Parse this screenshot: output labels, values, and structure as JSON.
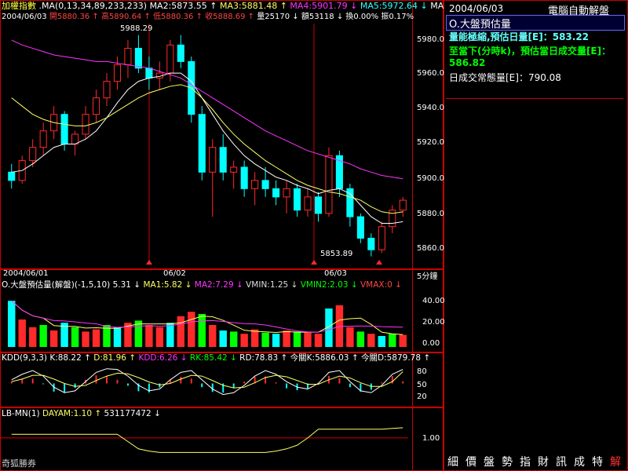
{
  "colors": {
    "up": "#ff2a2a",
    "down": "#00ffff",
    "ma_white": "#ffffff",
    "ma_yellow": "#ffff66",
    "ma_magenta": "#ff33ff",
    "volume_green": "#00ff00",
    "grid_red": "#cc0000"
  },
  "main": {
    "title": "加權指數",
    "ma_header": ".MA(0,13,34,89,233,233)",
    "ma2": "MA2:5873.55 ↑",
    "ma3": "MA3:5881.48 ↑",
    "ma4": "MA4:5901.79 ↓",
    "ma5": "MA5:5972.64 ↓",
    "ma_more": "MA",
    "date": "2004/06/03",
    "open": "開5880.36 ↑",
    "high": "高5890.64 ↑",
    "low": "低5880.36 ↑",
    "close": "收5888.69 ↑",
    "vol": "量25170 ↓",
    "amount": "額53118 ↓",
    "turnover": "換0.00%",
    "amplitude": "振0.17%",
    "yticks": [
      "5980.0",
      "5960.0",
      "5940.0",
      "5920.0",
      "5900.0",
      "5880.0",
      "5860.0"
    ],
    "annot_high": "5988.29",
    "annot_low": "5853.89",
    "x_labels": [
      "2004/06/01",
      "06/02",
      "06/03"
    ],
    "interval": "5分鐘"
  },
  "vol_panel": {
    "title": "O.大盤預估量(解盤)(-1,5,10)",
    "value": "5.31 ↓",
    "ma1": "MA1:5.82 ↓",
    "ma2": "MA2:7.29 ↓",
    "vmin": "VMIN:1.25 ↓",
    "vmin2": "VMIN2:2.03 ↓",
    "vmax": "VMAX:0 ↓",
    "yticks": [
      "40.00",
      "20.00",
      "0.00"
    ]
  },
  "kdd": {
    "title": "KDD(9,3,3)",
    "k": "K:88.22 ↑",
    "d": "D:81.96 ↑",
    "kdd": "KDD:6.26 ↓",
    "rk": "RK:85.42 ↓",
    "rd": "RD:78.83 ↑",
    "today_k": "今關K:5886.03 ↑",
    "today_d": "今關D:5879.78 ↑",
    "yticks": [
      "80",
      "50",
      "20"
    ]
  },
  "lbmn": {
    "title": "LB-MN(1)",
    "dayam": "DAYAM:1.10 ↑",
    "value": "531177472 ↓",
    "ytick": "1.00"
  },
  "footer": {
    "broker": "奇狐勝券"
  },
  "side": {
    "date": "2004/06/03",
    "brand": "電腦自動解盤",
    "section_title": "O.大盤預估量",
    "line1": "量能極縮,預估日量[E]：583.22",
    "line2": "至當下(分時k)，預估當日成交量[E]：586.82",
    "line3": "日成交常態量[E]：790.08",
    "buttons": [
      "細",
      "價",
      "盤",
      "勢",
      "指",
      "財",
      "訊",
      "成",
      "特",
      "解"
    ]
  },
  "chart_data": {
    "type": "candlestick",
    "interval": "5分鐘",
    "x_labels": [
      "2004/06/01",
      "06/02",
      "06/03"
    ],
    "ylim": [
      5850,
      5995
    ],
    "candles": [
      {
        "o": 5905,
        "h": 5910,
        "l": 5895,
        "c": 5900
      },
      {
        "o": 5900,
        "h": 5915,
        "l": 5898,
        "c": 5912
      },
      {
        "o": 5912,
        "h": 5925,
        "l": 5908,
        "c": 5920
      },
      {
        "o": 5920,
        "h": 5935,
        "l": 5915,
        "c": 5930
      },
      {
        "o": 5930,
        "h": 5945,
        "l": 5925,
        "c": 5940
      },
      {
        "o": 5940,
        "h": 5942,
        "l": 5918,
        "c": 5922
      },
      {
        "o": 5922,
        "h": 5930,
        "l": 5915,
        "c": 5928
      },
      {
        "o": 5928,
        "h": 5945,
        "l": 5925,
        "c": 5940
      },
      {
        "o": 5940,
        "h": 5955,
        "l": 5935,
        "c": 5950
      },
      {
        "o": 5950,
        "h": 5965,
        "l": 5945,
        "c": 5960
      },
      {
        "o": 5960,
        "h": 5975,
        "l": 5955,
        "c": 5970
      },
      {
        "o": 5970,
        "h": 5985,
        "l": 5962,
        "c": 5980
      },
      {
        "o": 5980,
        "h": 5988,
        "l": 5965,
        "c": 5968
      },
      {
        "o": 5968,
        "h": 5975,
        "l": 5955,
        "c": 5962
      },
      {
        "o": 5962,
        "h": 5972,
        "l": 5955,
        "c": 5965
      },
      {
        "o": 5965,
        "h": 5985,
        "l": 5960,
        "c": 5982
      },
      {
        "o": 5982,
        "h": 5988,
        "l": 5968,
        "c": 5972
      },
      {
        "o": 5972,
        "h": 5975,
        "l": 5935,
        "c": 5940
      },
      {
        "o": 5940,
        "h": 5945,
        "l": 5900,
        "c": 5905
      },
      {
        "o": 5905,
        "h": 5925,
        "l": 5878,
        "c": 5920
      },
      {
        "o": 5920,
        "h": 5928,
        "l": 5900,
        "c": 5905
      },
      {
        "o": 5905,
        "h": 5912,
        "l": 5895,
        "c": 5908
      },
      {
        "o": 5908,
        "h": 5912,
        "l": 5890,
        "c": 5895
      },
      {
        "o": 5895,
        "h": 5905,
        "l": 5885,
        "c": 5900
      },
      {
        "o": 5900,
        "h": 5908,
        "l": 5890,
        "c": 5895
      },
      {
        "o": 5895,
        "h": 5900,
        "l": 5885,
        "c": 5890
      },
      {
        "o": 5890,
        "h": 5900,
        "l": 5880,
        "c": 5895
      },
      {
        "o": 5895,
        "h": 5898,
        "l": 5878,
        "c": 5882
      },
      {
        "o": 5882,
        "h": 5895,
        "l": 5878,
        "c": 5890
      },
      {
        "o": 5890,
        "h": 5893,
        "l": 5875,
        "c": 5880
      },
      {
        "o": 5880,
        "h": 5920,
        "l": 5878,
        "c": 5915
      },
      {
        "o": 5915,
        "h": 5918,
        "l": 5890,
        "c": 5895
      },
      {
        "o": 5895,
        "h": 5898,
        "l": 5872,
        "c": 5878
      },
      {
        "o": 5878,
        "h": 5880,
        "l": 5862,
        "c": 5865
      },
      {
        "o": 5865,
        "h": 5868,
        "l": 5854,
        "c": 5858
      },
      {
        "o": 5858,
        "h": 5875,
        "l": 5856,
        "c": 5872
      },
      {
        "o": 5872,
        "h": 5885,
        "l": 5868,
        "c": 5882
      },
      {
        "o": 5882,
        "h": 5890,
        "l": 5878,
        "c": 5888
      }
    ],
    "ma_lines": [
      {
        "name": "MA2",
        "color": "#ffffff"
      },
      {
        "name": "MA3",
        "color": "#ffff66"
      },
      {
        "name": "MA4",
        "color": "#ff33ff"
      }
    ],
    "ma_white": [
      5905,
      5906,
      5910,
      5915,
      5920,
      5922,
      5922,
      5925,
      5930,
      5938,
      5947,
      5955,
      5960,
      5962,
      5963,
      5965,
      5965,
      5960,
      5950,
      5940,
      5930,
      5922,
      5915,
      5910,
      5906,
      5902,
      5900,
      5897,
      5895,
      5892,
      5894,
      5895,
      5892,
      5885,
      5878,
      5874,
      5874,
      5875
    ],
    "ma_yellow": [
      5950,
      5945,
      5940,
      5937,
      5935,
      5934,
      5933,
      5933,
      5935,
      5938,
      5942,
      5946,
      5950,
      5953,
      5955,
      5957,
      5958,
      5956,
      5950,
      5943,
      5935,
      5928,
      5922,
      5917,
      5912,
      5908,
      5904,
      5900,
      5897,
      5895,
      5893,
      5892,
      5890,
      5888,
      5884,
      5881,
      5880,
      5881
    ],
    "ma_magenta": [
      5985,
      5982,
      5980,
      5978,
      5976,
      5975,
      5974,
      5973,
      5972,
      5972,
      5971,
      5970,
      5969,
      5968,
      5966,
      5964,
      5962,
      5958,
      5954,
      5950,
      5946,
      5942,
      5938,
      5934,
      5930,
      5927,
      5924,
      5921,
      5918,
      5916,
      5914,
      5912,
      5910,
      5907,
      5905,
      5903,
      5902,
      5901
    ],
    "volume": [
      42,
      25,
      18,
      20,
      15,
      22,
      18,
      14,
      16,
      20,
      18,
      22,
      24,
      20,
      18,
      22,
      28,
      32,
      30,
      20,
      15,
      14,
      12,
      16,
      13,
      12,
      15,
      14,
      13,
      12,
      35,
      38,
      18,
      14,
      12,
      10,
      12,
      11
    ],
    "kdd_k": [
      60,
      75,
      85,
      70,
      40,
      25,
      30,
      55,
      80,
      90,
      88,
      70,
      45,
      30,
      35,
      60,
      80,
      85,
      60,
      35,
      20,
      25,
      45,
      70,
      85,
      75,
      55,
      40,
      35,
      50,
      80,
      85,
      55,
      30,
      25,
      45,
      75,
      88
    ],
    "kdd_d": [
      55,
      62,
      72,
      72,
      62,
      50,
      42,
      45,
      58,
      70,
      78,
      76,
      66,
      54,
      46,
      50,
      62,
      72,
      70,
      58,
      45,
      38,
      40,
      52,
      66,
      72,
      68,
      58,
      48,
      48,
      60,
      70,
      65,
      52,
      42,
      42,
      55,
      82
    ],
    "lbmn": [
      1.05,
      1.05,
      1.05,
      1.05,
      1.05,
      1.05,
      1.05,
      1.05,
      1.05,
      1.05,
      1.05,
      0.95,
      0.85,
      0.82,
      0.8,
      0.8,
      0.8,
      0.8,
      0.8,
      0.8,
      0.8,
      0.8,
      0.8,
      0.8,
      0.8,
      0.82,
      0.85,
      0.9,
      1.0,
      1.12,
      1.12,
      1.12,
      1.12,
      1.12,
      1.12,
      1.12,
      1.13,
      1.14
    ]
  }
}
